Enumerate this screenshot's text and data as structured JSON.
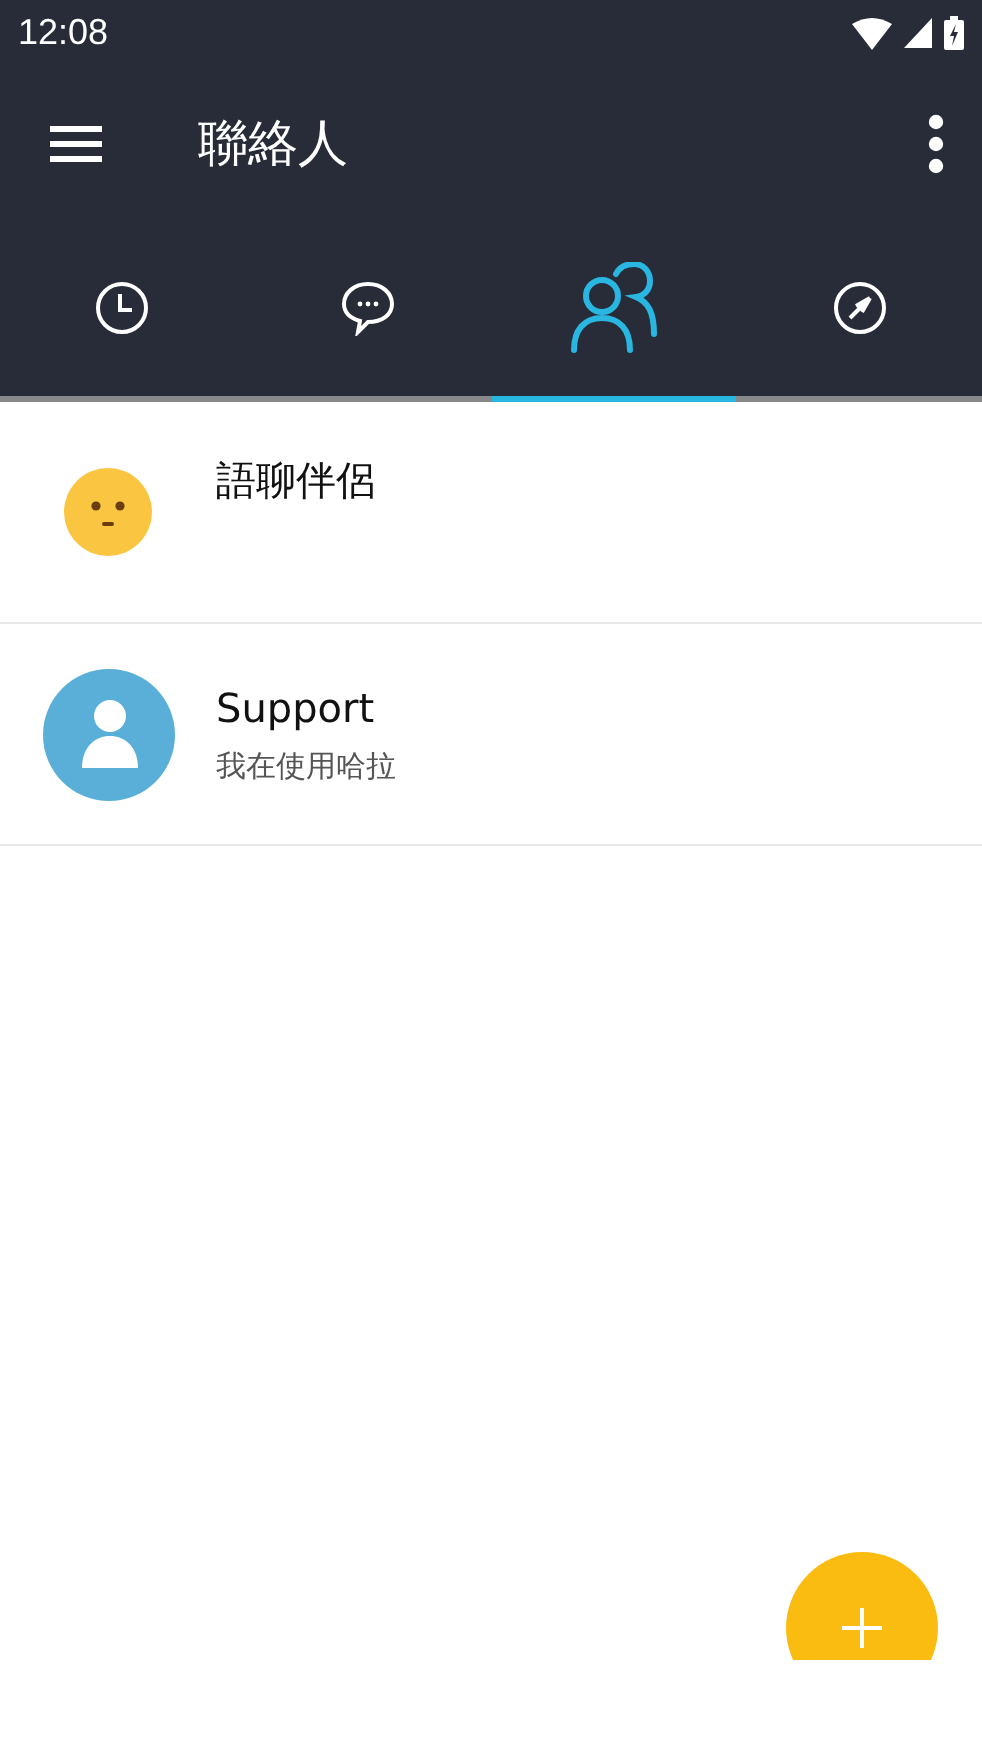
{
  "status_bar": {
    "time": "12:08"
  },
  "toolbar": {
    "title": "聯絡人"
  },
  "tabs": [
    {
      "kind": "clock",
      "selected": false
    },
    {
      "kind": "chat",
      "selected": false
    },
    {
      "kind": "people",
      "selected": true
    },
    {
      "kind": "compass",
      "selected": false
    }
  ],
  "contacts": [
    {
      "kind": "emoji",
      "name": "語聊伴侶"
    },
    {
      "kind": "person",
      "name": "Support",
      "status": "我在使用哈拉"
    }
  ]
}
